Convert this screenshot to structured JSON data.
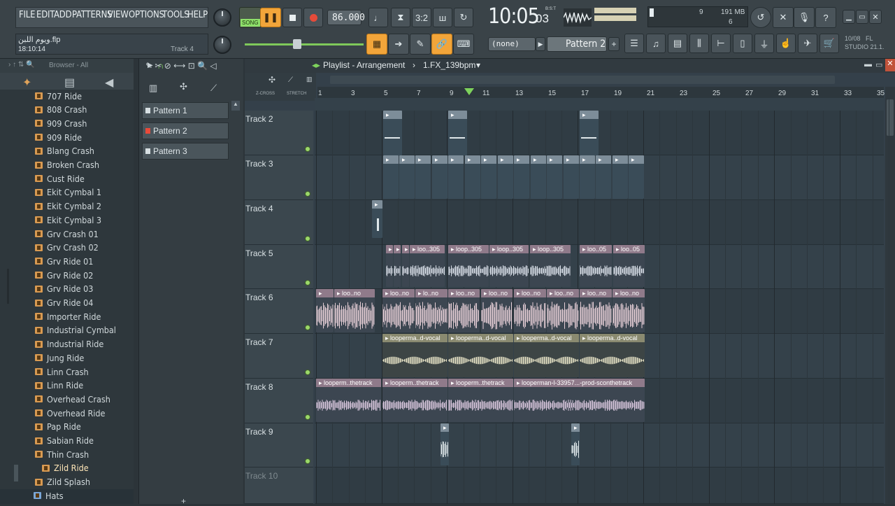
{
  "menu": [
    "FILE",
    "EDIT",
    "ADD",
    "PATTERNS",
    "VIEW",
    "OPTIONS",
    "TOOLS",
    "HELP"
  ],
  "project": {
    "filename": "ويوم اللبن.flp",
    "time": "18:10:14",
    "hint": "Track 4"
  },
  "transport": {
    "mode_label": "SONG",
    "tempo": "86.000",
    "clock": "10:05",
    "clock_small": "03",
    "clock_unit": "B:S:T"
  },
  "monitor": {
    "cpu": "9",
    "memory": "191 MB",
    "polyphony": "6"
  },
  "pattern_select": {
    "current": "Pattern 2",
    "none_label": "(none)"
  },
  "version": {
    "date": "10/08",
    "app": "FL",
    "name": "STUDIO 21.1."
  },
  "browser": {
    "title": "Browser - All",
    "items": [
      "707 Ride",
      "808 Crash",
      "909 Crash",
      "909 Ride",
      "Blang Crash",
      "Broken Crash",
      "Cust Ride",
      "Ekit Cymbal 1",
      "Ekit Cymbal 2",
      "Ekit Cymbal 3",
      "Grv Crash 01",
      "Grv Crash 02",
      "Grv Ride 01",
      "Grv Ride 02",
      "Grv Ride 03",
      "Grv Ride 04",
      "Importer Ride",
      "Industrial Cymbal",
      "Industrial Ride",
      "Jung Ride",
      "Linn Crash",
      "Linn Ride",
      "Overhead Crash",
      "Overhead Ride",
      "Pap Ride",
      "Sabian Ride",
      "Thin Crash",
      "Zild Ride",
      "Zild Splash",
      "Hats"
    ],
    "selected": "Zild Ride"
  },
  "patterns": [
    "Pattern 1",
    "Pattern 2",
    "Pattern 3"
  ],
  "playlist": {
    "title": "Playlist - Arrangement",
    "arrangement": "1.FX_139bpm",
    "zcross": "Z-CROSS",
    "stretch": "STRETCH",
    "ruler": [
      "1",
      "3",
      "5",
      "7",
      "9",
      "11",
      "13",
      "15",
      "17",
      "19",
      "21",
      "23",
      "25",
      "27",
      "29",
      "31",
      "33",
      "35"
    ],
    "tracks": [
      "Track 2",
      "Track 3",
      "Track 4",
      "Track 5",
      "Track 6",
      "Track 7",
      "Track 8",
      "Track 9",
      "Track 10"
    ]
  },
  "clip_labels": {
    "t5": [
      "loo..305",
      "loop..305",
      "loop..305",
      "loop..305",
      "loo..05",
      "loo..05"
    ],
    "t6": [
      "loo..no",
      "loo..no",
      "lo..no",
      "loo..no",
      "loo..no",
      "loo..no",
      "loo..no",
      "loo..no",
      "loo..no",
      "loo..no"
    ],
    "t7": [
      "looperma..d-vocal",
      "looperma..d-vocal",
      "looperma..d-vocal",
      "looperma..d-vocal"
    ],
    "t8": [
      "looperm..thetrack",
      "looperm..thetrack",
      "looperm..thetrack",
      "looperman-l-33957...-prod-sconthetrack"
    ]
  },
  "colors": {
    "accent": "#f2a53a",
    "playhead": "#7ed35c",
    "led": "#9bd86a",
    "rec": "#ff3d22"
  }
}
